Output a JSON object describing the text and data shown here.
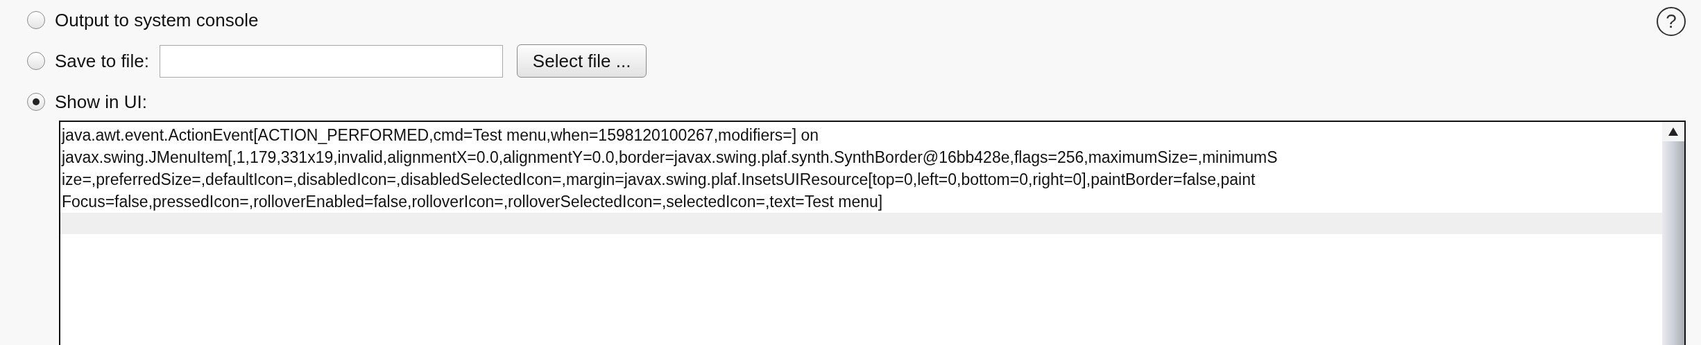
{
  "options": [
    {
      "kind": "plain",
      "label": "Output to system console",
      "selected": false
    },
    {
      "kind": "file",
      "label": "Save to file:",
      "selected": false,
      "button": "Select file ..."
    },
    {
      "kind": "ui",
      "label": "Show in UI:",
      "selected": true
    }
  ],
  "help": {
    "label": "?"
  },
  "output": {
    "lines": [
      "java.awt.event.ActionEvent[ACTION_PERFORMED,cmd=Test menu,when=1598120100267,modifiers=] on",
      "javax.swing.JMenuItem[,1,179,331x19,invalid,alignmentX=0.0,alignmentY=0.0,border=javax.swing.plaf.synth.SynthBorder@16bb428e,flags=256,maximumSize=,minimumS",
      "ize=,preferredSize=,defaultIcon=,disabledIcon=,disabledSelectedIcon=,margin=javax.swing.plaf.InsetsUIResource[top=0,left=0,bottom=0,right=0],paintBorder=false,paint",
      "Focus=false,pressedIcon=,rolloverEnabled=false,rolloverIcon=,rolloverSelectedIcon=,selectedIcon=,text=Test menu]"
    ]
  }
}
